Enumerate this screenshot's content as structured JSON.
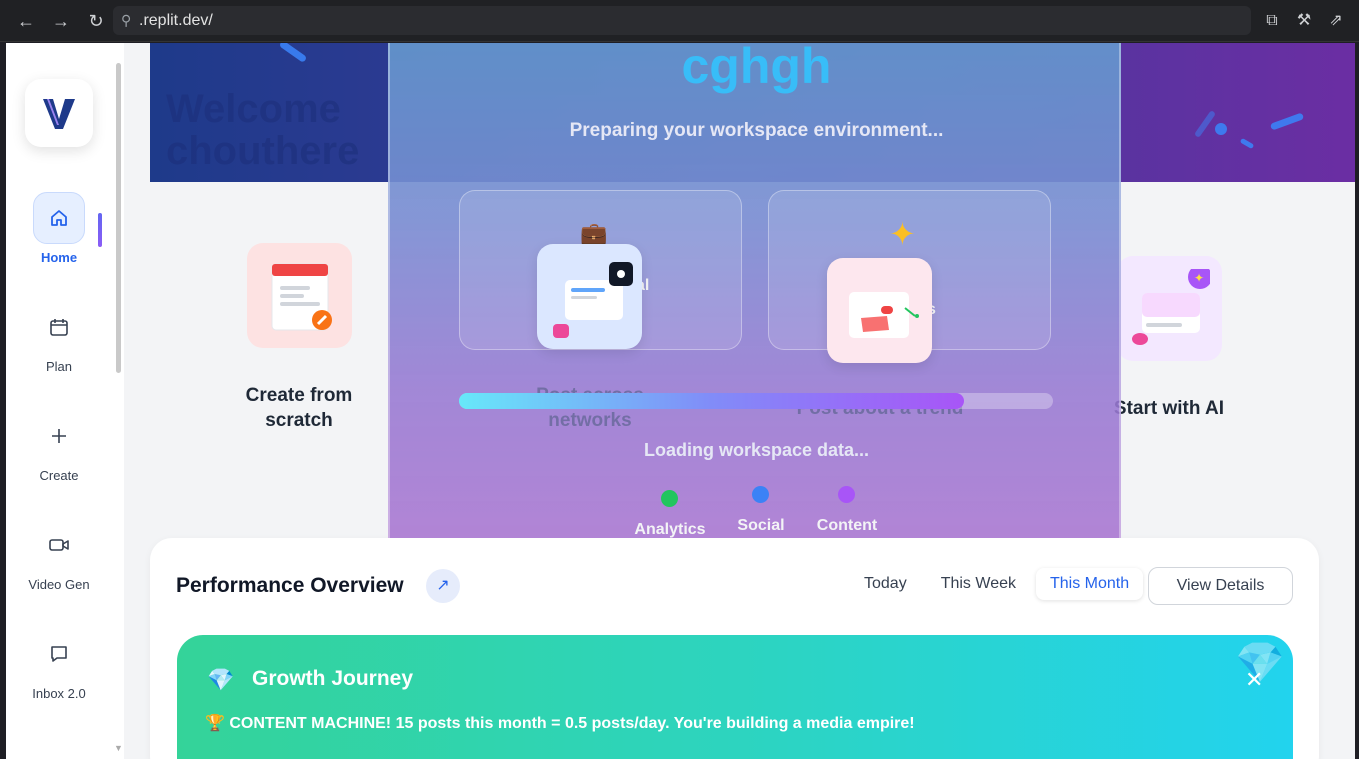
{
  "browser": {
    "url": ".replit.dev/",
    "back_icon": "arrow-left-icon",
    "forward_icon": "arrow-right-icon",
    "reload_icon": "reload-icon"
  },
  "sidebar": {
    "items": [
      {
        "label": "Home",
        "icon": "home-icon",
        "active": true
      },
      {
        "label": "Plan",
        "icon": "calendar-icon"
      },
      {
        "label": "Create",
        "icon": "plus-icon"
      },
      {
        "label": "Video Gen",
        "icon": "video-icon"
      },
      {
        "label": "Inbox 2.0",
        "icon": "chat-icon"
      }
    ]
  },
  "quick_actions": [
    {
      "label_line1": "Create from",
      "label_line2": "scratch"
    },
    {
      "label_line1": "Post across",
      "label_line2": "networks"
    },
    {
      "label_line1": "Post about a trend",
      "label_line2": ""
    },
    {
      "label_line1": "Start with AI",
      "label_line2": ""
    }
  ],
  "loading_overlay": {
    "title": "cghgh",
    "subtitle": "Preparing your workspace environment...",
    "card_left_text": "al",
    "card_right_text": "s",
    "progress": 0.85,
    "loading_text": "Loading workspace data...",
    "modules": [
      {
        "label": "Analytics",
        "color": "#22c55e"
      },
      {
        "label": "Social",
        "color": "#3b82f6"
      },
      {
        "label": "Content",
        "color": "#a855f7"
      }
    ]
  },
  "performance": {
    "title": "Performance Overview",
    "tabs": [
      "Today",
      "This Week",
      "This Month"
    ],
    "active_tab": "This Month",
    "view_details": "View Details",
    "growth": {
      "title": "Growth Journey",
      "message": "🏆 CONTENT MACHINE! 15 posts this month = 0.5 posts/day. You're building a media empire!"
    }
  },
  "colors": {
    "accent": "#2563eb",
    "overlay_title": "#38bdf8",
    "growth_start": "#34d399",
    "growth_end": "#22d3ee"
  }
}
